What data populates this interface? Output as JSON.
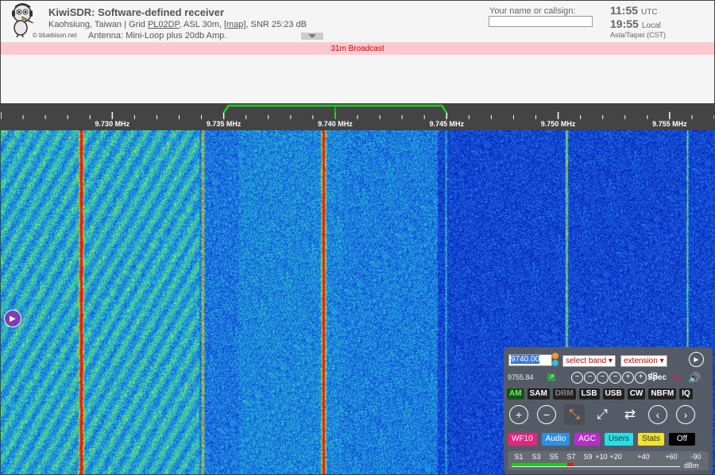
{
  "header": {
    "title": "KiwiSDR: Software-defined receiver",
    "location": "Kaohsiung, Taiwan | Grid",
    "grid": "PL02DP",
    "asl": ", ASL 30m, ",
    "map_link": "[map]",
    "snr": ", SNR 25:23 dB",
    "credit": "© bluebison.net",
    "antenna": "Antenna: Mini-Loop plus 20db Amp.",
    "callsign_label": "Your name or callsign:",
    "callsign_value": "",
    "utc_time": "11:55",
    "utc_label": "UTC",
    "local_time": "19:55",
    "local_label": "Local",
    "timezone": "Asia/Taipei (CST)"
  },
  "band_bar": {
    "label": "31m Broadcast"
  },
  "scale": {
    "ticks": [
      "9.730 MHz",
      "9.735 MHz",
      "9.740 MHz",
      "9.745 MHz",
      "9.750 MHz",
      "9.755 MHz"
    ],
    "passband_low_khz": 9735.0,
    "passband_high_khz": 9745.0,
    "tuned_khz": 9740.0
  },
  "control_panel": {
    "frequency_input": "9740.00",
    "band_select": "select band",
    "extension_select": "extension",
    "secondary_freq": "9755.84",
    "spec_label": "Spec",
    "zoom_buttons": [
      "−",
      "−",
      "−",
      "−",
      "+",
      "+",
      "+"
    ],
    "zoom_db_label": "dB",
    "modes": [
      "AM",
      "SAM",
      "DRM",
      "LSB",
      "USB",
      "CW",
      "NBFM",
      "IQ"
    ],
    "active_mode": "AM",
    "buttons": {
      "wf": "WF10",
      "audio": "Audio",
      "agc": "AGC",
      "users": "Users",
      "stats": "Stats",
      "off": "Off"
    },
    "smeter": {
      "labels": [
        "S1",
        "S3",
        "S5",
        "S7",
        "S9",
        "+10",
        "+20",
        "+40",
        "+60",
        "-90"
      ],
      "unit": "dBm",
      "level_fraction": 0.33
    }
  },
  "colors": {
    "band_bar_bg": "#ffc8cf",
    "band_bar_text": "#cc0000",
    "passband": "#19d11a",
    "panel_bg": "#555b66",
    "wf_button": "#e0267d",
    "audio_button": "#2f8fe0",
    "agc_button": "#b52fc5",
    "users_button": "#24e0e8",
    "stats_button": "#f0e030",
    "off_button": "#000000"
  }
}
